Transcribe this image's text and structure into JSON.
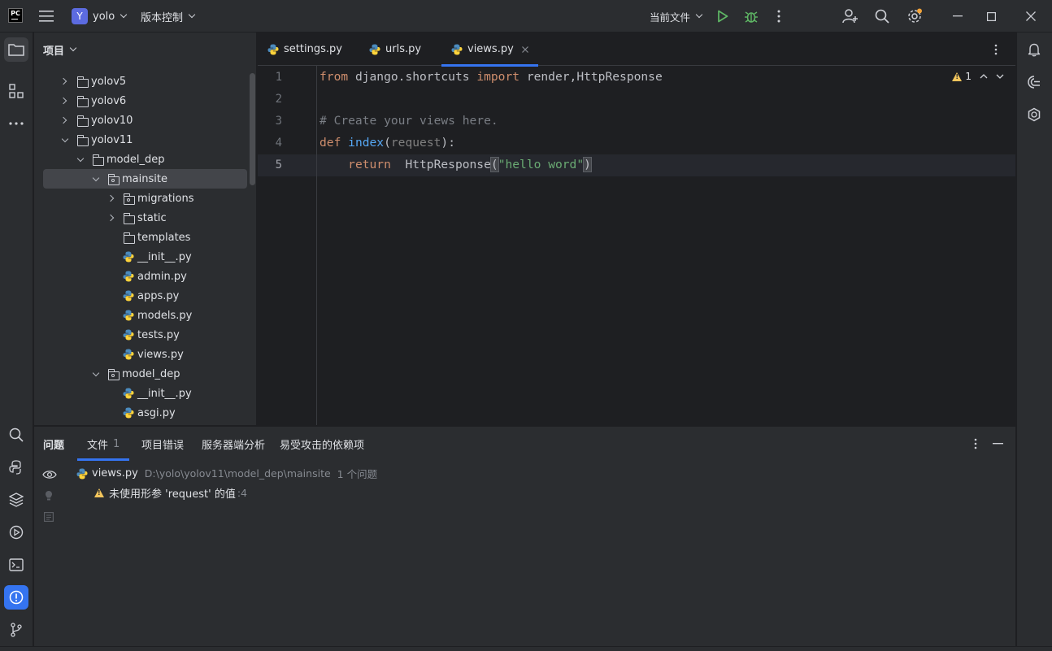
{
  "titlebar": {
    "app_logo": "PC",
    "project_badge": "Y",
    "project_name": "yolo",
    "vcs_label": "版本控制",
    "run_config": "当前文件",
    "icons": [
      "hamburger-menu-icon",
      "run-icon",
      "debug-icon",
      "more-vertical-icon",
      "add-user-icon",
      "search-icon",
      "settings-icon",
      "minimize-icon",
      "maximize-icon",
      "close-icon"
    ]
  },
  "project_panel": {
    "title": "项目",
    "tree": [
      {
        "label": "yolov5",
        "type": "folder",
        "expanded": false,
        "depth": 1
      },
      {
        "label": "yolov6",
        "type": "folder",
        "expanded": false,
        "depth": 1
      },
      {
        "label": "yolov10",
        "type": "folder",
        "expanded": false,
        "depth": 1
      },
      {
        "label": "yolov11",
        "type": "folder",
        "expanded": true,
        "depth": 1
      },
      {
        "label": "model_dep",
        "type": "folder",
        "expanded": true,
        "depth": 2
      },
      {
        "label": "mainsite",
        "type": "package",
        "expanded": true,
        "depth": 3,
        "selected": true
      },
      {
        "label": "migrations",
        "type": "package",
        "expanded": false,
        "depth": 4
      },
      {
        "label": "static",
        "type": "folder",
        "expanded": false,
        "depth": 4
      },
      {
        "label": "templates",
        "type": "folder",
        "depth": 4
      },
      {
        "label": "__init__.py",
        "type": "python",
        "depth": 4
      },
      {
        "label": "admin.py",
        "type": "python",
        "depth": 4
      },
      {
        "label": "apps.py",
        "type": "python",
        "depth": 4
      },
      {
        "label": "models.py",
        "type": "python",
        "depth": 4
      },
      {
        "label": "tests.py",
        "type": "python",
        "depth": 4
      },
      {
        "label": "views.py",
        "type": "python",
        "depth": 4
      },
      {
        "label": "model_dep",
        "type": "package",
        "expanded": true,
        "depth": 3
      },
      {
        "label": "__init__.py",
        "type": "python",
        "depth": 4
      },
      {
        "label": "asgi.py",
        "type": "python",
        "depth": 4
      }
    ]
  },
  "editor": {
    "tabs": [
      {
        "label": "settings.py",
        "active": false
      },
      {
        "label": "urls.py",
        "active": false
      },
      {
        "label": "views.py",
        "active": true
      }
    ],
    "line_numbers": [
      "1",
      "2",
      "3",
      "4",
      "5"
    ],
    "warning_count": "1",
    "code": {
      "l1_from": "from",
      "l1_module": " django.shortcuts ",
      "l1_import": "import",
      "l1_names": " render,HttpResponse",
      "l3_comment": "# Create your views here.",
      "l4_def": "def",
      "l4_space": " ",
      "l4_fn": "index",
      "l4_open": "(",
      "l4_param": "request",
      "l4_close": "):",
      "l5_indent": "    ",
      "l5_return": "return",
      "l5_call": "  HttpResponse",
      "l5_open": "(",
      "l5_str": "\"hello word\"",
      "l5_close": ")"
    }
  },
  "problems": {
    "tabs": [
      {
        "label": "问题"
      },
      {
        "label": "文件",
        "count": "1",
        "active": true
      },
      {
        "label": "项目错误"
      },
      {
        "label": "服务器端分析"
      },
      {
        "label": "易受攻击的依赖项"
      }
    ],
    "file_entry": {
      "filename": "views.py",
      "path": "D:\\yolo\\yolov11\\model_dep\\mainsite",
      "summary": "1 个问题"
    },
    "issue": {
      "message": "未使用形参 'request' 的值",
      "line_ref": ":4"
    }
  },
  "colors": {
    "accent": "#3574f0",
    "keyword": "#cf8e6d",
    "function": "#56a8f5",
    "string": "#6aab73",
    "comment": "#7a7e85",
    "warning": "#f2c55c",
    "run_green": "#5fb865"
  }
}
